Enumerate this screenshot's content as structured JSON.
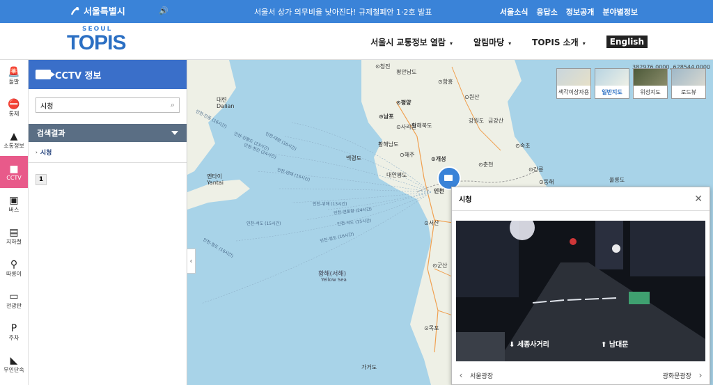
{
  "topbar": {
    "logo_text": "서울특별시",
    "speaker_icon": "speaker-icon",
    "notice": "서울서 상가 의무비율 낮아진다! 규제철폐안 1·2호 발표",
    "links": [
      "서울소식",
      "응답소",
      "정보공개",
      "분야별정보"
    ]
  },
  "header": {
    "brand_small": "SEOUL",
    "brand_large": "TOPIS",
    "nav": [
      {
        "label": "서울시 교통정보 열람",
        "caret": "▾"
      },
      {
        "label": "알림마당",
        "caret": "▾"
      },
      {
        "label": "TOPIS 소개",
        "caret": "▾"
      }
    ],
    "english": "English"
  },
  "leftnav": [
    {
      "label": "돌발",
      "icon": "siren-icon",
      "glyph": "🚨"
    },
    {
      "label": "통제",
      "icon": "no-entry-icon",
      "glyph": "⛔"
    },
    {
      "label": "소통정보",
      "icon": "road-icon",
      "glyph": "▲"
    },
    {
      "label": "CCTV",
      "icon": "cctv-icon",
      "glyph": "■",
      "active": true
    },
    {
      "label": "버스",
      "icon": "bus-icon",
      "glyph": "▣"
    },
    {
      "label": "지하철",
      "icon": "subway-icon",
      "glyph": "▤"
    },
    {
      "label": "따릉이",
      "icon": "bicycle-icon",
      "glyph": "⚲"
    },
    {
      "label": "전광판",
      "icon": "signboard-icon",
      "glyph": "▭"
    },
    {
      "label": "주차",
      "icon": "parking-icon",
      "glyph": "P"
    },
    {
      "label": "무인단속",
      "icon": "speed-camera-icon",
      "glyph": "◣"
    }
  ],
  "panel": {
    "title": "CCTV 정보",
    "search_value": "시청",
    "results_title": "검색결과",
    "results": [
      "시청"
    ],
    "page": "1"
  },
  "map": {
    "coords": "382976.0000, 628544.0000",
    "map_types": [
      {
        "label": "색각이상자용",
        "selected": false
      },
      {
        "label": "일반지도",
        "selected": true
      },
      {
        "label": "위성지도",
        "selected": false
      },
      {
        "label": "로드뷰",
        "selected": false
      }
    ],
    "labels": {
      "cheongjin": "⊙청진",
      "pyongannamdo": "평안남도",
      "pyongyang": "⊙평양",
      "hamhung": "⊙함흥",
      "wonsan": "⊙원산",
      "nampo": "⊙남포",
      "sariwon": "⊙사리원",
      "kangwondo_n": "강원도",
      "geumgangsan": "금강산",
      "hwanghaebukdo": "황해북도",
      "hwanghaenamdo": "황해남도",
      "haeju": "⊙해주",
      "kaesong": "⊙개성",
      "sokcho": "⊙속초",
      "chuncheon": "⊙춘천",
      "gangneung": "⊙강릉",
      "donghae": "⊙동해",
      "baengnyeongdo": "백령도",
      "yeonpyeongdo": "대연평도",
      "dalian": "대련",
      "dalian_en": "Dalian",
      "yantai": "옌타이",
      "yantai_en": "Yantai",
      "incheon": "인천",
      "seosan": "⊙서산",
      "gunsan": "⊙군산",
      "mokpo": "⊙목포",
      "yellow_sea": "황해(서해)",
      "yellow_sea_en": "Yellow Sea",
      "gageodo": "가거도",
      "ulleungdo": "울릉도"
    },
    "routes": [
      "인천-대련 (16시간)",
      "인천-단둥 (16시간)",
      "인천-진황도 (23시간)",
      "인천-천진 (24시간)",
      "인천-연태 (15시간)",
      "인천-위해 (13시간)",
      "인천-연운항 (24시간)",
      "인천-석도 (15시간)",
      "인천-청도 (16시간)",
      "인천-제주도",
      "인천-석도 (15시간)"
    ]
  },
  "popup": {
    "title": "시청",
    "direction_left": "세종사거리",
    "direction_right": "남대문",
    "prev_label": "서울광장",
    "next_label": "광화문광장"
  }
}
